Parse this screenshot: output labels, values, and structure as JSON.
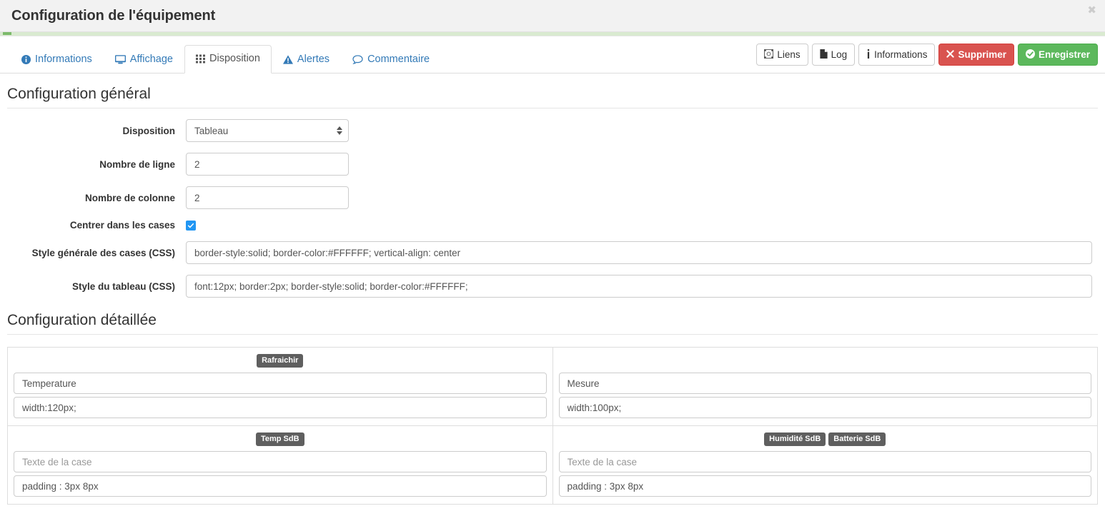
{
  "modal": {
    "title": "Configuration de l'équipement",
    "close_label": "✖"
  },
  "tabs": [
    {
      "label": "Informations",
      "icon": "info-circle-icon",
      "active": false
    },
    {
      "label": "Affichage",
      "icon": "desktop-icon",
      "active": false
    },
    {
      "label": "Disposition",
      "icon": "grid-icon",
      "active": true
    },
    {
      "label": "Alertes",
      "icon": "warning-triangle-icon",
      "active": false
    },
    {
      "label": "Commentaire",
      "icon": "comment-icon",
      "active": false
    }
  ],
  "actions": [
    {
      "label": "Liens",
      "icon": "link-network-icon",
      "style": "default"
    },
    {
      "label": "Log",
      "icon": "file-icon",
      "style": "default"
    },
    {
      "label": "Informations",
      "icon": "info-icon",
      "style": "default"
    },
    {
      "label": "Supprimer",
      "icon": "times-icon",
      "style": "danger"
    },
    {
      "label": "Enregistrer",
      "icon": "check-circle-icon",
      "style": "success"
    }
  ],
  "sections": {
    "general_title": "Configuration général",
    "detail_title": "Configuration détaillée"
  },
  "form": {
    "disposition": {
      "label": "Disposition",
      "value": "Tableau",
      "options": [
        "Tableau"
      ]
    },
    "rows": {
      "label": "Nombre de ligne",
      "value": "2"
    },
    "columns": {
      "label": "Nombre de colonne",
      "value": "2"
    },
    "center": {
      "label": "Centrer dans les cases",
      "checked": true
    },
    "cell_style": {
      "label": "Style générale des cases (CSS)",
      "value": "border-style:solid; border-color:#FFFFFF; vertical-align: center"
    },
    "table_style": {
      "label": "Style du tableau (CSS)",
      "value": "font:12px; border:2px; border-style:solid; border-color:#FFFFFF;"
    }
  },
  "detail_cells": [
    {
      "badges": [
        "Rafraichir"
      ],
      "text_value": "Temperature",
      "text_placeholder": "Texte de la case",
      "style_value": "width:120px;",
      "style_placeholder": "Style de la case"
    },
    {
      "badges": [],
      "text_value": "Mesure",
      "text_placeholder": "Texte de la case",
      "style_value": "width:100px;",
      "style_placeholder": "Style de la case"
    },
    {
      "badges": [
        "Temp SdB"
      ],
      "text_value": "",
      "text_placeholder": "Texte de la case",
      "style_value": "padding : 3px 8px",
      "style_placeholder": "Style de la case"
    },
    {
      "badges": [
        "Humidité SdB",
        "Batterie SdB"
      ],
      "text_value": "",
      "text_placeholder": "Texte de la case",
      "style_value": "padding : 3px 8px",
      "style_placeholder": "Style de la case"
    }
  ],
  "colors": {
    "link": "#337ab7",
    "danger": "#d9534f",
    "success": "#5cb85c",
    "badge": "#5f5f5f",
    "progress": "#7cba6b",
    "checkbox": "#2196f3"
  }
}
